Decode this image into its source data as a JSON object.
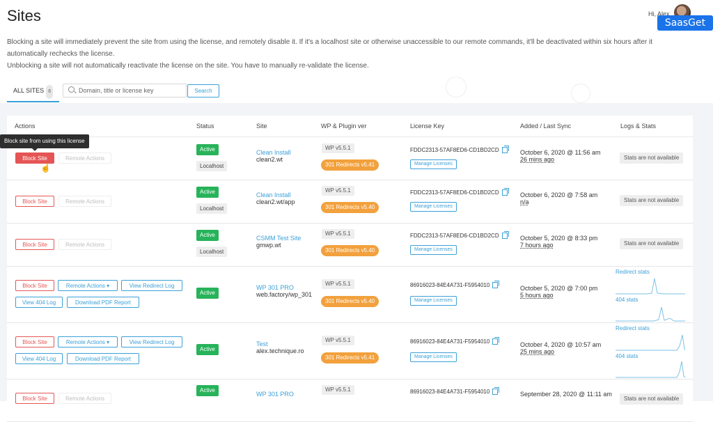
{
  "header": {
    "title": "Sites",
    "greeting": "Hi, Alex",
    "watermark": "SaasGet"
  },
  "description": {
    "line1": "Blocking a site will immediately prevent the site from using the license, and remotely disable it. If it's a localhost site or otherwise unaccessible to our remote commands, it'll be deactivated within six hours after it automatically rechecks the license.",
    "line2": "Unblocking a site will not automatically reactivate the license on the site. You have to manually re-validate the license."
  },
  "tabs": {
    "all_label": "ALL SITES",
    "all_count": "6"
  },
  "search": {
    "placeholder": "Domain, title or license key",
    "button": "Search"
  },
  "columns": [
    "Actions",
    "Status",
    "Site",
    "WP & Plugin ver",
    "License Key",
    "Added / Last Sync",
    "Logs & Stats"
  ],
  "tooltip": "Block site from using this license",
  "labels": {
    "block": "Block Site",
    "remote": "Remote Actions",
    "remote_dropdown": "Remote Actions ▾",
    "view_redirect": "View Redirect Log",
    "view_404": "View 404 Log",
    "download_pdf": "Download PDF Report",
    "manage": "Manage Licenses",
    "stats_na": "Stats are not available",
    "redirect_stats": "Redirect stats",
    "stats_404": "404 stats"
  },
  "rows": [
    {
      "status": "Active",
      "localhost": "Localhost",
      "site_title": "Clean Install",
      "site_path": "clean2.wt",
      "wp": "WP v5.5.1",
      "plugin": "301 Redirects v5.41",
      "key": "FDDC2313-57AF8ED6-CD1BD2CD",
      "added": "October 6, 2020 @ 11:56 am",
      "sync": "26 mins ago"
    },
    {
      "status": "Active",
      "localhost": "Localhost",
      "site_title": "Clean Install",
      "site_path": "clean2.wt/app",
      "wp": "WP v5.5.1",
      "plugin": "301 Redirects v5.40",
      "key": "FDDC2313-57AF8ED6-CD1BD2CD",
      "added": "October 6, 2020 @ 7:58 am",
      "sync": "n/a"
    },
    {
      "status": "Active",
      "localhost": "Localhost",
      "site_title": "CSMM Test Site",
      "site_path": "gmwp.wt",
      "wp": "WP v5.5.1",
      "plugin": "301 Redirects v5.40",
      "key": "FDDC2313-57AF8ED6-CD1BD2CD",
      "added": "October 5, 2020 @ 8:33 pm",
      "sync": "7 hours ago"
    },
    {
      "status": "Active",
      "site_title": "WP 301 PRO",
      "site_path": "web.factory/wp_301",
      "wp": "WP v5.5.1",
      "plugin": "301 Redirects v5.40",
      "key": "86916023-84E4A731-F5954010",
      "added": "October 5, 2020 @ 7:00 pm",
      "sync": "5 hours ago"
    },
    {
      "status": "Active",
      "site_title": "Test",
      "site_path": "alex.technique.ro",
      "wp": "WP v5.5.1",
      "plugin": "301 Redirects v5.41",
      "key": "86916023-84E4A731-F5954010",
      "added": "October 4, 2020 @ 10:57 am",
      "sync": "25 mins ago"
    },
    {
      "status": "Active",
      "site_title": "WP 301 PRO",
      "site_path": "",
      "wp": "WP v5.5.1",
      "plugin": "",
      "key": "86916023-84E4A731-F5954010",
      "added": "September 28, 2020 @ 11:11 am",
      "sync": ""
    }
  ],
  "colors": {
    "accent": "#3aa0d8",
    "danger": "#e55555",
    "success": "#27b35a",
    "warning": "#f2a13d"
  }
}
